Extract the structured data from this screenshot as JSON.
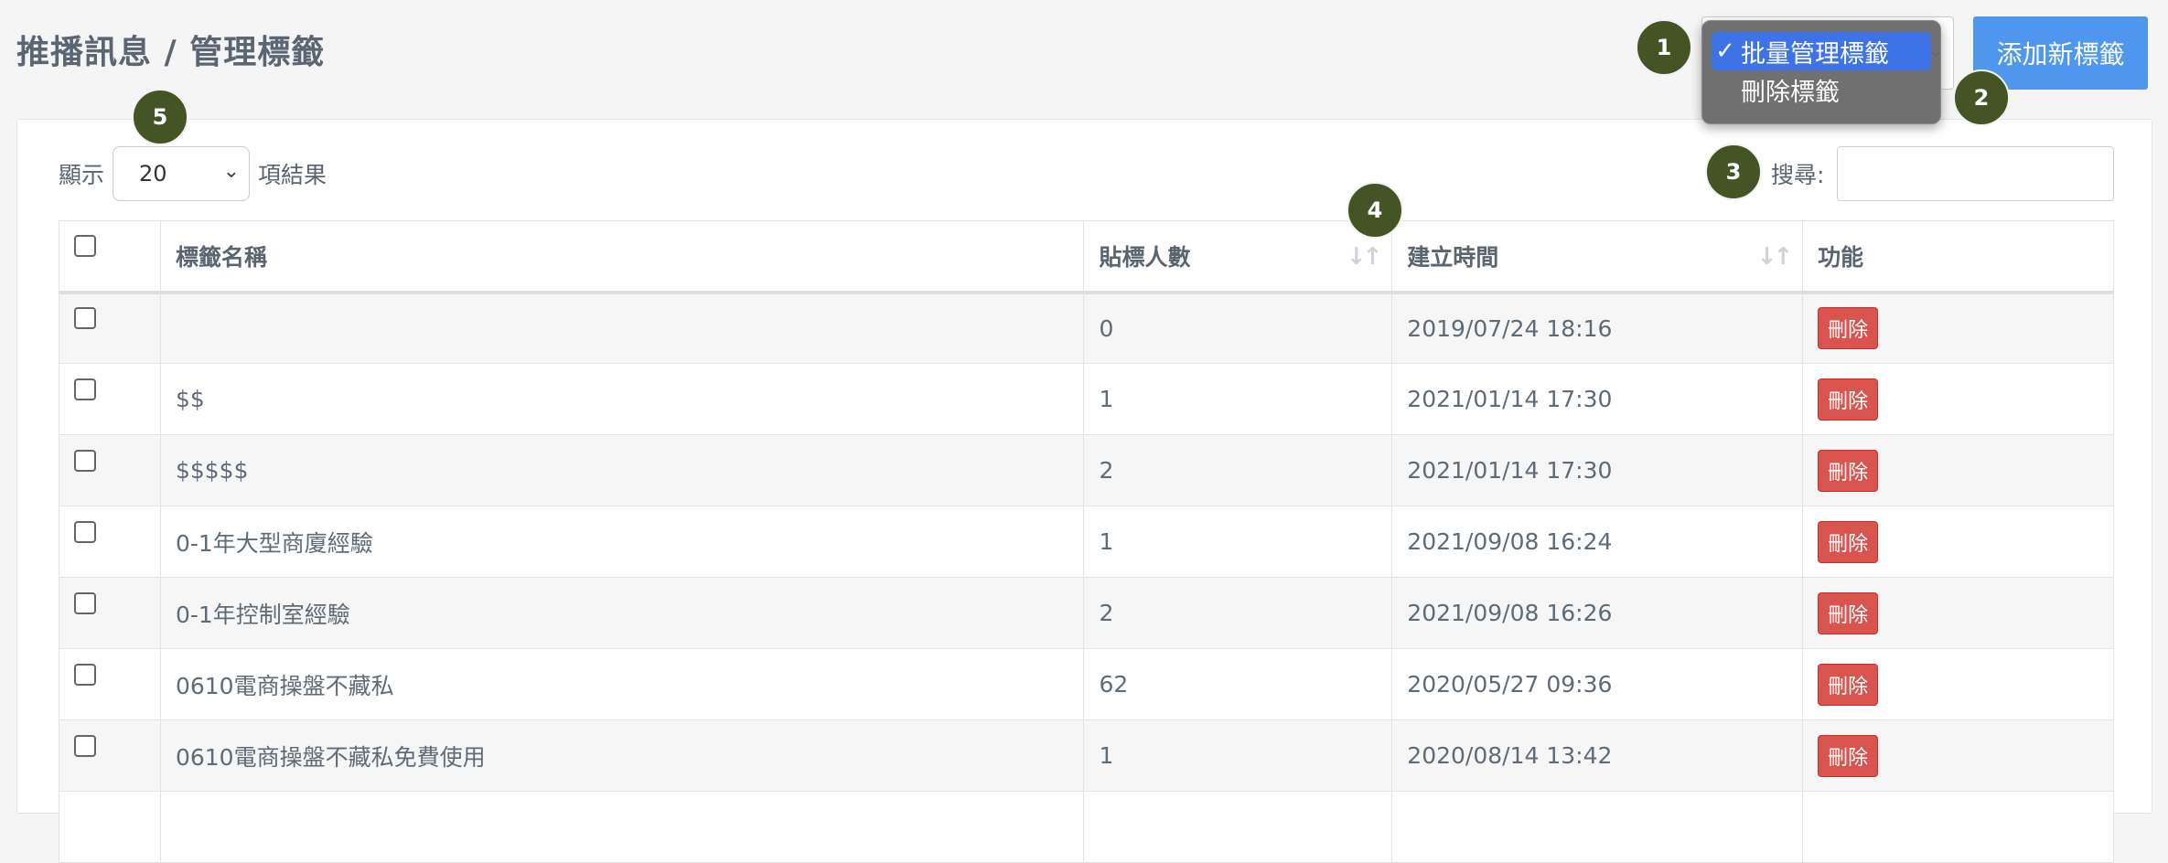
{
  "header": {
    "title": "推播訊息 / 管理標籤",
    "add_button": "添加新標籤",
    "batch_dropdown": {
      "options": [
        {
          "label": "批量管理標籤",
          "selected": true
        },
        {
          "label": "刪除標籤",
          "selected": false
        }
      ],
      "checkmark": "✓"
    }
  },
  "controls": {
    "length_prefix": "顯示",
    "length_value": "20",
    "length_suffix": "項結果",
    "search_label": "搜尋:",
    "search_value": ""
  },
  "table": {
    "columns": [
      "標籤名稱",
      "貼標人數",
      "建立時間",
      "功能"
    ],
    "rows": [
      {
        "name": "",
        "count": "0",
        "created": "2019/07/24 18:16",
        "action": "刪除"
      },
      {
        "name": "$$",
        "count": "1",
        "created": "2021/01/14 17:30",
        "action": "刪除"
      },
      {
        "name": "$$$$$",
        "count": "2",
        "created": "2021/01/14 17:30",
        "action": "刪除"
      },
      {
        "name": "0-1年大型商廈經驗",
        "count": "1",
        "created": "2021/09/08 16:24",
        "action": "刪除"
      },
      {
        "name": "0-1年控制室經驗",
        "count": "2",
        "created": "2021/09/08 16:26",
        "action": "刪除"
      },
      {
        "name": "0610電商操盤不藏私",
        "count": "62",
        "created": "2020/05/27 09:36",
        "action": "刪除"
      },
      {
        "name": "0610電商操盤不藏私免費使用",
        "count": "1",
        "created": "2020/08/14 13:42",
        "action": "刪除"
      },
      {
        "name": "",
        "count": "",
        "created": "",
        "action": ""
      }
    ]
  },
  "annotations": [
    "1",
    "2",
    "3",
    "4",
    "5"
  ],
  "colors": {
    "primary": "#4f97ee",
    "danger": "#d9534f",
    "badge": "#445425",
    "menu_highlight": "#3d73e6"
  }
}
